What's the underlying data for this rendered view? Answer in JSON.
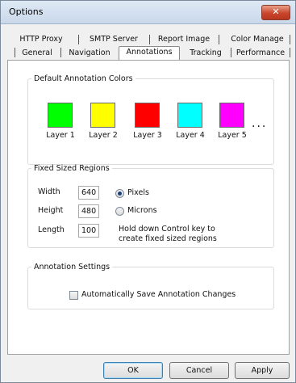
{
  "window": {
    "title": "Options",
    "close_glyph": "✕"
  },
  "tabs_row1": [
    {
      "label": "HTTP Proxy"
    },
    {
      "label": "SMTP Server"
    },
    {
      "label": "Report Image"
    },
    {
      "label": "Color Manage"
    }
  ],
  "tabs_row2": [
    {
      "label": "General"
    },
    {
      "label": "Navigation"
    },
    {
      "label": "Annotations",
      "selected": true
    },
    {
      "label": "Tracking"
    },
    {
      "label": "Performance"
    }
  ],
  "annotation_colors": {
    "legend": "Default Annotation Colors",
    "layers": [
      {
        "label": "Layer 1",
        "color": "#00ff00"
      },
      {
        "label": "Layer 2",
        "color": "#ffff00"
      },
      {
        "label": "Layer 3",
        "color": "#ff0000"
      },
      {
        "label": "Layer 4",
        "color": "#00ffff"
      },
      {
        "label": "Layer 5",
        "color": "#ff00ff"
      }
    ],
    "more": "..."
  },
  "fixed_regions": {
    "legend": "Fixed Sized Regions",
    "width_label": "Width",
    "width_value": "640",
    "height_label": "Height",
    "height_value": "480",
    "length_label": "Length",
    "length_value": "100",
    "unit_pixels": "Pixels",
    "unit_microns": "Microns",
    "selected_unit": "Pixels",
    "hint_line1": "Hold down Control key to",
    "hint_line2": "create fixed sized regions"
  },
  "annotation_settings": {
    "legend": "Annotation Settings",
    "auto_save_label": "Automatically Save Annotation Changes",
    "auto_save_checked": false
  },
  "buttons": {
    "ok": "OK",
    "cancel": "Cancel",
    "apply": "Apply"
  }
}
